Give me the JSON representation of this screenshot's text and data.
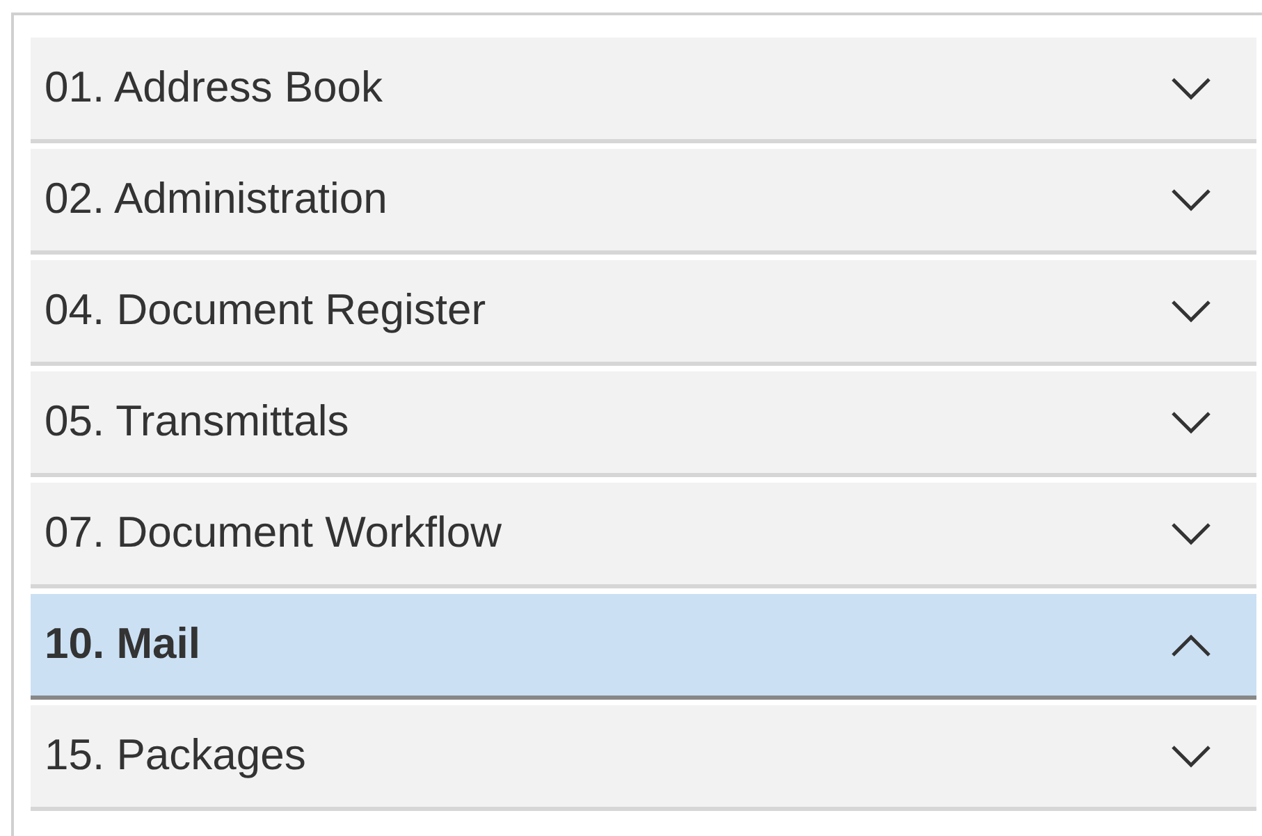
{
  "sections": [
    {
      "label": "01. Address Book",
      "selected": false,
      "expanded": false
    },
    {
      "label": "02. Administration",
      "selected": false,
      "expanded": false
    },
    {
      "label": "04. Document Register",
      "selected": false,
      "expanded": false
    },
    {
      "label": "05. Transmittals",
      "selected": false,
      "expanded": false
    },
    {
      "label": "07. Document Workflow",
      "selected": false,
      "expanded": false
    },
    {
      "label": "10. Mail",
      "selected": true,
      "expanded": true
    },
    {
      "label": "15. Packages",
      "selected": false,
      "expanded": false
    }
  ]
}
